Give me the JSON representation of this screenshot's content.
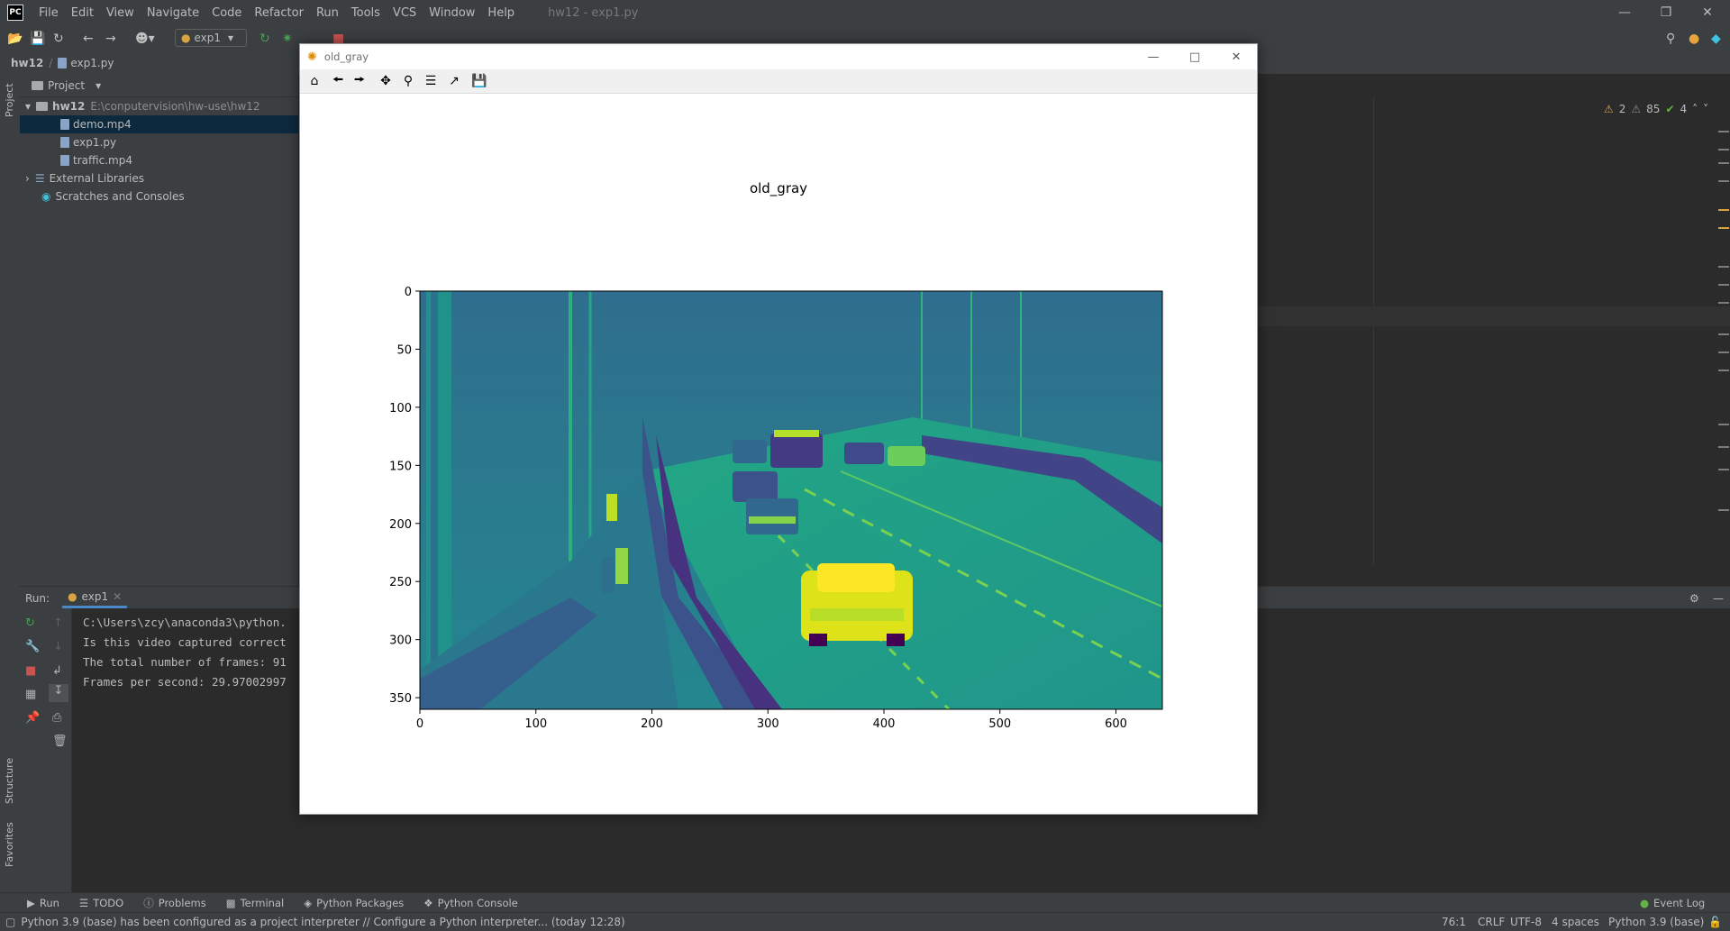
{
  "menubar": {
    "logo": "PC",
    "items": [
      "File",
      "Edit",
      "View",
      "Navigate",
      "Code",
      "Refactor",
      "Run",
      "Tools",
      "VCS",
      "Window",
      "Help"
    ],
    "file_title": "hw12 - exp1.py"
  },
  "toolbar": {
    "run_config": "exp1"
  },
  "breadcrumb": {
    "project": "hw12",
    "file": "exp1.py"
  },
  "left_strip": {
    "project_label": "Project",
    "structure_label": "Structure",
    "favorites_label": "Favorites"
  },
  "project_panel": {
    "header": "Project",
    "root_name": "hw12",
    "root_path": "E:\\conputervision\\hw-use\\hw12",
    "files": [
      "demo.mp4",
      "exp1.py",
      "traffic.mp4"
    ],
    "external_libraries": "External Libraries",
    "scratches": "Scratches and Consoles"
  },
  "inspections": {
    "warnings": "2",
    "weak_warnings": "85",
    "typos": "4"
  },
  "run_panel": {
    "label": "Run:",
    "tab": "exp1",
    "console_lines": [
      "C:\\Users\\zcy\\anaconda3\\python.",
      "Is this video captured correct",
      "The total number of frames: 91",
      "Frames per second: 29.97002997"
    ]
  },
  "bottom_tools": [
    "Run",
    "TODO",
    "Problems",
    "Terminal",
    "Python Packages",
    "Python Console"
  ],
  "event_log": "Event Log",
  "status": {
    "message": "Python 3.9 (base) has been configured as a project interpreter // Configure a Python interpreter... (today 12:28)",
    "position": "76:1",
    "line_ending": "CRLF",
    "encoding": "UTF-8",
    "indent": "4 spaces",
    "interpreter": "Python 3.9 (base)"
  },
  "figure_window": {
    "title": "old_gray",
    "tool_icons": [
      "home-icon",
      "back-arrow-icon",
      "forward-arrow-icon",
      "pan-icon",
      "zoom-icon",
      "configure-subplots-icon",
      "edit-axis-icon",
      "save-icon"
    ]
  },
  "chart_data": {
    "type": "heatmap",
    "title": "old_gray",
    "xlabel": "",
    "ylabel": "",
    "x_ticks": [
      0,
      100,
      200,
      300,
      400,
      500,
      600
    ],
    "y_ticks": [
      0,
      50,
      100,
      150,
      200,
      250,
      300,
      350
    ],
    "xlim": [
      0,
      640
    ],
    "ylim": [
      360,
      0
    ],
    "colormap": "viridis",
    "image_description_shown": "grayscale video frame rendered in viridis colormap"
  },
  "colors": {
    "ide_bg": "#2b2b2b",
    "panel_bg": "#3c3f41",
    "selection": "#0d293e",
    "viridis_dark": "#440154",
    "viridis_mid": "#21918c",
    "viridis_bright": "#fde725"
  }
}
